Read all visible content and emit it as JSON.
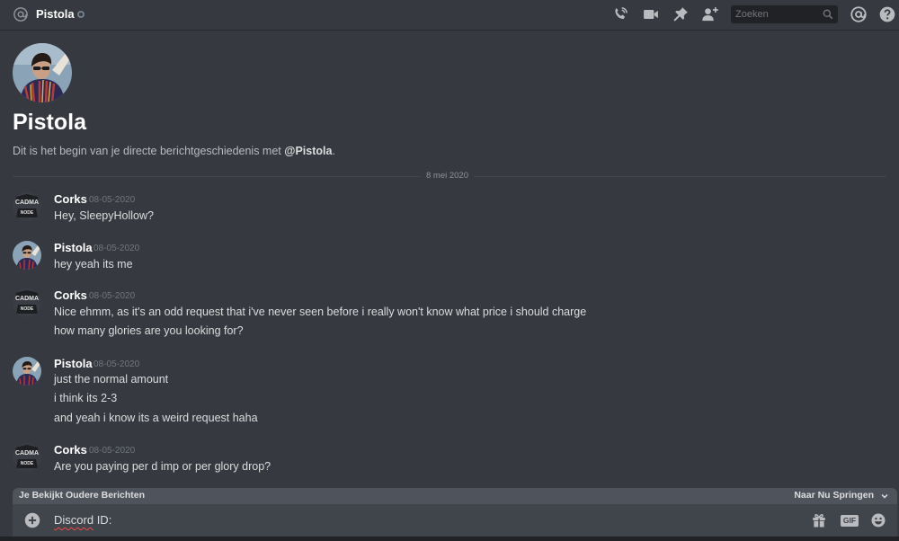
{
  "header": {
    "channel_name": "Pistola",
    "search_placeholder": "Zoeken",
    "icons": [
      "at-icon",
      "status-offline-icon",
      "phone-call-icon",
      "video-call-icon",
      "pin-icon",
      "add-friend-icon",
      "search-icon",
      "mentions-icon",
      "help-icon"
    ]
  },
  "intro": {
    "title": "Pistola",
    "text_prefix": "Dit is het begin van je directe berichtgeschiedenis met ",
    "mention": "@Pistola",
    "text_suffix": "."
  },
  "date_divider": "8 mei 2020",
  "messages": [
    {
      "author": "Corks",
      "timestamp": "08-05-2020",
      "avatar": "corks-avatar",
      "lines": [
        "Hey, SleepyHollow?"
      ]
    },
    {
      "author": "Pistola",
      "timestamp": "08-05-2020",
      "avatar": "pistola-avatar",
      "lines": [
        "hey yeah its me"
      ]
    },
    {
      "author": "Corks",
      "timestamp": "08-05-2020",
      "avatar": "corks-avatar",
      "lines": [
        "Nice ehmm, as it's an odd request that i've never seen before i really won't know what price i should charge",
        "how many glories are you looking for?"
      ]
    },
    {
      "author": "Pistola",
      "timestamp": "08-05-2020",
      "avatar": "pistola-avatar",
      "lines": [
        "just the normal amount",
        "i think its 2-3",
        "and yeah i know its a weird request haha"
      ]
    },
    {
      "author": "Corks",
      "timestamp": "08-05-2020",
      "avatar": "corks-avatar",
      "lines": [
        "Are you paying per d imp or per glory drop?"
      ]
    }
  ],
  "corks_avatar_text": {
    "top": "CADMA",
    "bottom": "NODE"
  },
  "older_messages_bar": {
    "label": "Je Bekijkt Oudere Berichten",
    "jump_label": "Naar Nu Springen"
  },
  "composer": {
    "value_word": "Discord",
    "value_rest": " ID:",
    "gif_label": "GIF"
  },
  "colors": {
    "background": "#36393f",
    "input_background": "#40444b",
    "older_bar": "#4f535c",
    "username": "#ffffff",
    "text": "#dcddde",
    "muted": "#72767d"
  }
}
